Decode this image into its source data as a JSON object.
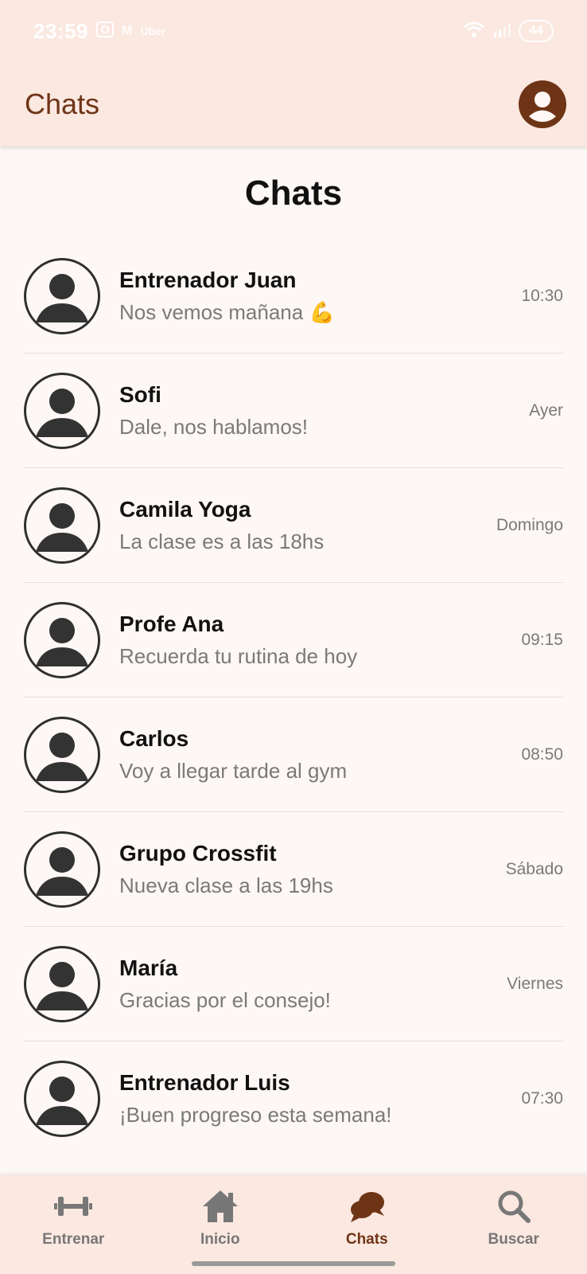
{
  "status_bar": {
    "time": "23:59",
    "icons_left": [
      "gallery-icon",
      "gmail-icon",
      "uber-icon"
    ],
    "gmail_glyph": "M",
    "uber_text": "Uber",
    "battery": "44"
  },
  "app_bar": {
    "title": "Chats"
  },
  "page": {
    "heading": "Chats"
  },
  "chats": [
    {
      "name": "Entrenador Juan",
      "message": "Nos vemos mañana 💪",
      "time": "10:30"
    },
    {
      "name": "Sofi",
      "message": "Dale, nos hablamos!",
      "time": "Ayer"
    },
    {
      "name": "Camila Yoga",
      "message": "La clase es a las 18hs",
      "time": "Domingo"
    },
    {
      "name": "Profe Ana",
      "message": "Recuerda tu rutina de hoy",
      "time": "09:15"
    },
    {
      "name": "Carlos",
      "message": "Voy a llegar tarde al gym",
      "time": "08:50"
    },
    {
      "name": "Grupo Crossfit",
      "message": "Nueva clase a las 19hs",
      "time": "Sábado"
    },
    {
      "name": "María",
      "message": "Gracias por el consejo!",
      "time": "Viernes"
    },
    {
      "name": "Entrenador Luis",
      "message": "¡Buen progreso esta semana!",
      "time": "07:30"
    }
  ],
  "bottom_nav": {
    "items": [
      {
        "label": "Entrenar",
        "icon": "dumbbell-icon",
        "active": false
      },
      {
        "label": "Inicio",
        "icon": "home-icon",
        "active": false
      },
      {
        "label": "Chats",
        "icon": "chat-bubbles-icon",
        "active": true
      },
      {
        "label": "Buscar",
        "icon": "search-icon",
        "active": false
      }
    ]
  },
  "colors": {
    "accent": "#6e3416",
    "bar_background": "#fbe8e0",
    "page_background": "#fdf8f5",
    "inactive_nav": "#777777"
  }
}
